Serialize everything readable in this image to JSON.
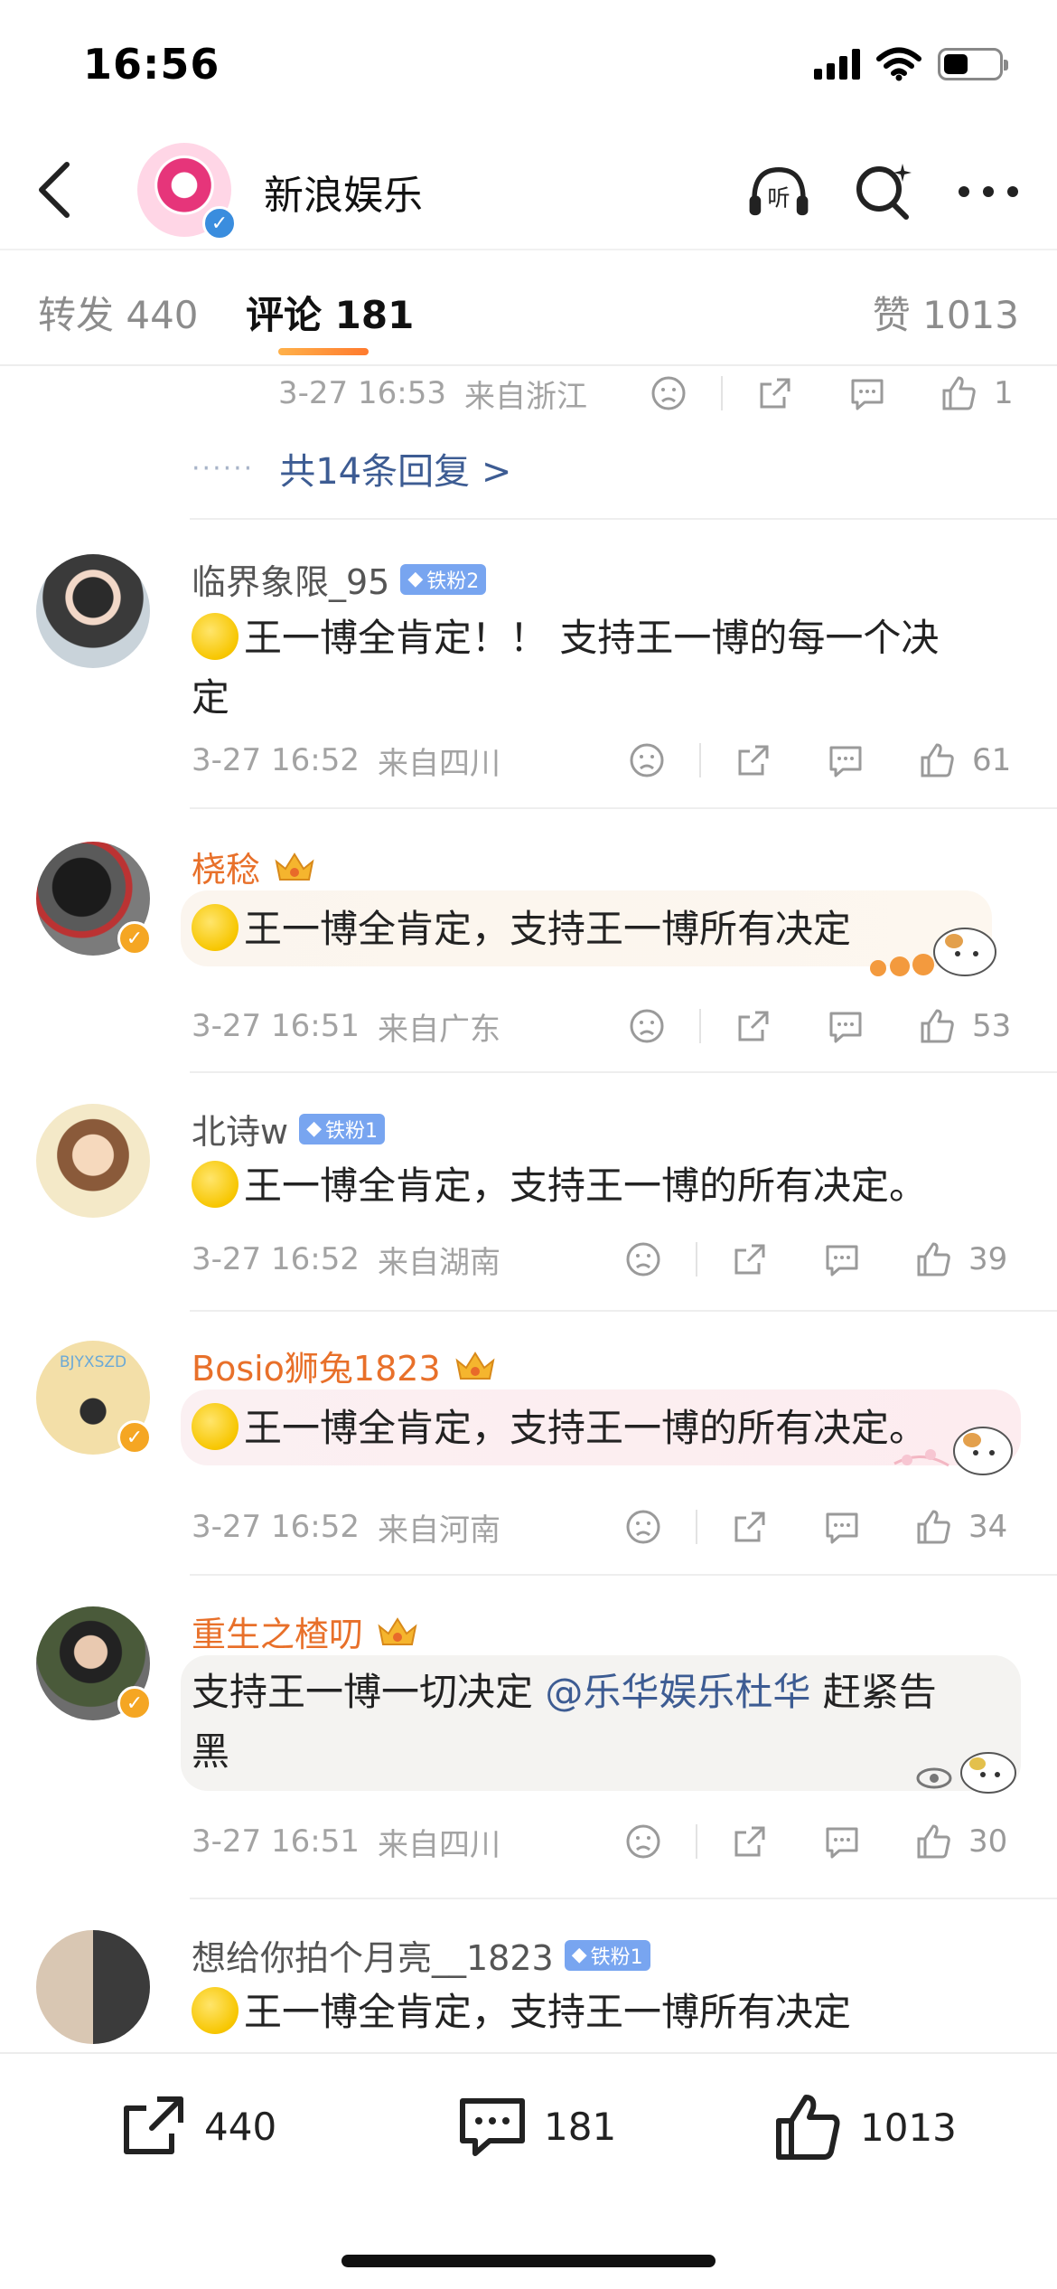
{
  "status_bar": {
    "time": "16:56",
    "battery_level": 0.45
  },
  "header": {
    "title": "新浪娱乐",
    "listen_label": "听"
  },
  "tabs": [
    {
      "label": "转发 440"
    },
    {
      "label": "评论 181"
    },
    {
      "label": "赞 1013"
    }
  ],
  "prev_comment": {
    "time": "3-27 16:53",
    "location": "来自浙江",
    "likes": "1",
    "replies_link": "共14条回复 >"
  },
  "comments": [
    {
      "name": "临界象限_95",
      "fan_badge": "铁粉2",
      "text_line1": "王一博全肯定！！ 支持王一博的每一个决",
      "text_line2": "定",
      "time": "3-27 16:52",
      "location": "来自四川",
      "likes": "61"
    },
    {
      "name": "桡稔",
      "text_line1": "王一博全肯定，支持王一博所有决定",
      "time": "3-27 16:51",
      "location": "来自广东",
      "likes": "53"
    },
    {
      "name": "北诗w",
      "fan_badge": "铁粉1",
      "text_line1": "王一博全肯定，支持王一博的所有决定。",
      "time": "3-27 16:52",
      "location": "来自湖南",
      "likes": "39"
    },
    {
      "name": "Bosio狮兔1823",
      "avatar_text": "BJYXSZD",
      "text_line1": "王一博全肯定，支持王一博的所有决定。",
      "time": "3-27 16:52",
      "location": "来自河南",
      "likes": "34"
    },
    {
      "name": "重生之楂叨",
      "text_before": "支持王一博一切决定 ",
      "mention": "@乐华娱乐杜华",
      "text_after": " 赶紧告",
      "text_line2": "黑",
      "time": "3-27 16:51",
      "location": "来自四川",
      "likes": "30"
    },
    {
      "name": "想给你拍个月亮__1823",
      "fan_badge": "铁粉1",
      "text_line1": "王一博全肯定，支持王一博所有决定"
    }
  ],
  "bottom_bar": {
    "reposts": "440",
    "comments": "181",
    "likes": "1013"
  },
  "colors": {
    "accent": "#ff8a35",
    "vip_name": "#e8702a",
    "link": "#3d5c93",
    "fan_badge": "#78a5f0"
  }
}
